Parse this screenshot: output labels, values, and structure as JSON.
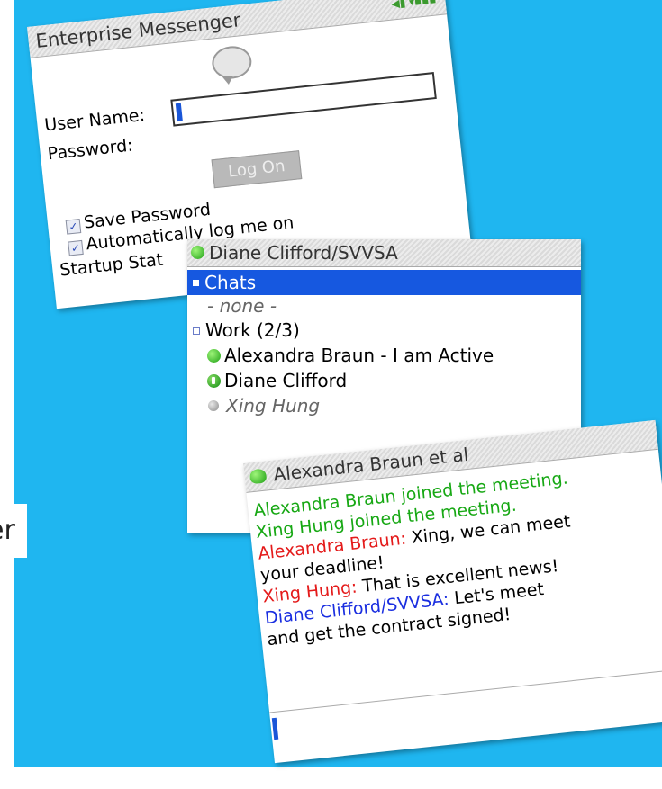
{
  "accent_color": "#1fb6f0",
  "partial_text": "er",
  "login": {
    "title": "Enterprise Messenger",
    "user_name_label": "User Name:",
    "password_label": "Password:",
    "logon_button": "Log On",
    "save_password_label": "Save Password",
    "auto_logon_label": "Automatically log me on",
    "startup_status_label": "Startup Stat"
  },
  "contacts": {
    "title": "Diane Clifford/SVVSA",
    "groups": [
      {
        "label": "Chats",
        "selected": true
      },
      {
        "label": "Work (2/3)",
        "selected": false
      }
    ],
    "chats_empty": "- none -",
    "contacts": [
      {
        "name": "Alexandra Braun - I am Active",
        "status": "active"
      },
      {
        "name": "Diane Clifford",
        "status": "mobile"
      },
      {
        "name": "Xing Hung",
        "status": "offline"
      }
    ]
  },
  "chat": {
    "title": "Alexandra Braun et al",
    "lines": [
      {
        "speaker": "",
        "text": "Alexandra Braun joined the meeting."
      },
      {
        "speaker": "",
        "text": "Xing Hung joined the meeting."
      },
      {
        "speaker": "Alexandra Braun:",
        "text": " Xing, we can meet"
      },
      {
        "speaker": "",
        "text": "your deadline!"
      },
      {
        "speaker": "Xing Hung:",
        "text": " That is excellent news!"
      },
      {
        "speaker": "Diane Clifford/SVVSA:",
        "text": " Let's meet"
      },
      {
        "speaker": "",
        "text": "and get the contract signed!"
      }
    ]
  }
}
